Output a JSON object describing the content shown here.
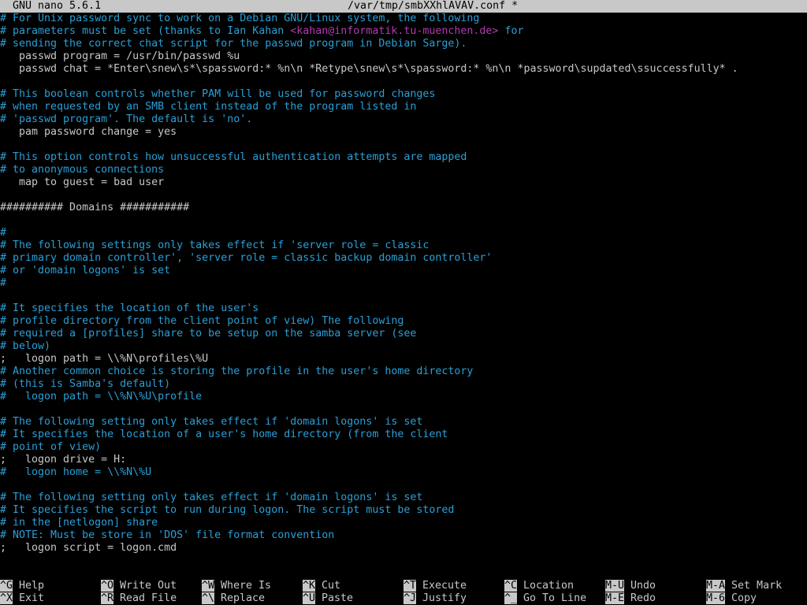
{
  "title_bar": {
    "app": "GNU nano 5.6.1",
    "file": "/var/tmp/smbXXhlAVAV.conf *"
  },
  "editor_lines": [
    {
      "type": "comment",
      "text": "# For Unix password sync to work on a Debian GNU/Linux system, the following"
    },
    {
      "type": "comment-email",
      "before": "# parameters must be set (thanks to Ian Kahan <",
      "email": "<kahan@informatik.tu-muenchen.de>",
      "after": " for"
    },
    {
      "type": "comment",
      "text": "# sending the correct chat script for the passwd program in Debian Sarge)."
    },
    {
      "type": "setting",
      "text": "   passwd program = /usr/bin/passwd %u"
    },
    {
      "type": "setting",
      "text": "   passwd chat = *Enter\\snew\\s*\\spassword:* %n\\n *Retype\\snew\\s*\\spassword:* %n\\n *password\\supdated\\ssuccessfully* ."
    },
    {
      "type": "blank",
      "text": ""
    },
    {
      "type": "comment",
      "text": "# This boolean controls whether PAM will be used for password changes"
    },
    {
      "type": "comment",
      "text": "# when requested by an SMB client instead of the program listed in"
    },
    {
      "type": "comment",
      "text": "# 'passwd program'. The default is 'no'."
    },
    {
      "type": "setting",
      "text": "   pam password change = yes"
    },
    {
      "type": "blank",
      "text": ""
    },
    {
      "type": "comment",
      "text": "# This option controls how unsuccessful authentication attempts are mapped"
    },
    {
      "type": "comment",
      "text": "# to anonymous connections"
    },
    {
      "type": "setting",
      "text": "   map to guest = bad user"
    },
    {
      "type": "blank",
      "text": ""
    },
    {
      "type": "setting",
      "text": "########## Domains ###########"
    },
    {
      "type": "blank",
      "text": ""
    },
    {
      "type": "comment",
      "text": "#"
    },
    {
      "type": "comment",
      "text": "# The following settings only takes effect if 'server role = classic"
    },
    {
      "type": "comment",
      "text": "# primary domain controller', 'server role = classic backup domain controller'"
    },
    {
      "type": "comment",
      "text": "# or 'domain logons' is set"
    },
    {
      "type": "comment",
      "text": "#"
    },
    {
      "type": "blank",
      "text": ""
    },
    {
      "type": "comment",
      "text": "# It specifies the location of the user's"
    },
    {
      "type": "comment",
      "text": "# profile directory from the client point of view) The following"
    },
    {
      "type": "comment",
      "text": "# required a [profiles] share to be setup on the samba server (see"
    },
    {
      "type": "comment",
      "text": "# below)"
    },
    {
      "type": "setting",
      "text": ";   logon path = \\\\%N\\profiles\\%U"
    },
    {
      "type": "comment",
      "text": "# Another common choice is storing the profile in the user's home directory"
    },
    {
      "type": "comment",
      "text": "# (this is Samba's default)"
    },
    {
      "type": "comment",
      "text": "#   logon path = \\\\%N\\%U\\profile"
    },
    {
      "type": "blank",
      "text": ""
    },
    {
      "type": "comment",
      "text": "# The following setting only takes effect if 'domain logons' is set"
    },
    {
      "type": "comment",
      "text": "# It specifies the location of a user's home directory (from the client"
    },
    {
      "type": "comment",
      "text": "# point of view)"
    },
    {
      "type": "setting",
      "text": ";   logon drive = H:"
    },
    {
      "type": "comment",
      "text": "#   logon home = \\\\%N\\%U"
    },
    {
      "type": "blank",
      "text": ""
    },
    {
      "type": "comment",
      "text": "# The following setting only takes effect if 'domain logons' is set"
    },
    {
      "type": "comment",
      "text": "# It specifies the script to run during logon. The script must be stored"
    },
    {
      "type": "comment",
      "text": "# in the [netlogon] share"
    },
    {
      "type": "comment",
      "text": "# NOTE: Must be store in 'DOS' file format convention"
    },
    {
      "type": "setting",
      "text": ";   logon script = logon.cmd"
    }
  ],
  "shortcuts": [
    {
      "key": "^G",
      "label": "Help"
    },
    {
      "key": "^X",
      "label": "Exit"
    },
    {
      "key": "^O",
      "label": "Write Out"
    },
    {
      "key": "^R",
      "label": "Read File"
    },
    {
      "key": "^W",
      "label": "Where Is"
    },
    {
      "key": "^\\",
      "label": "Replace"
    },
    {
      "key": "^K",
      "label": "Cut"
    },
    {
      "key": "^U",
      "label": "Paste"
    },
    {
      "key": "^T",
      "label": "Execute"
    },
    {
      "key": "^J",
      "label": "Justify"
    },
    {
      "key": "^C",
      "label": "Location"
    },
    {
      "key": "^_",
      "label": "Go To Line"
    },
    {
      "key": "M-U",
      "label": "Undo"
    },
    {
      "key": "M-E",
      "label": "Redo"
    },
    {
      "key": "M-A",
      "label": "Set Mark"
    },
    {
      "key": "M-6",
      "label": "Copy"
    }
  ],
  "colors": {
    "comment": "#2a9fd6",
    "text": "#c8c8c8",
    "email": "#b23ab2",
    "background": "#000000",
    "bar": "#c8c8c8"
  }
}
